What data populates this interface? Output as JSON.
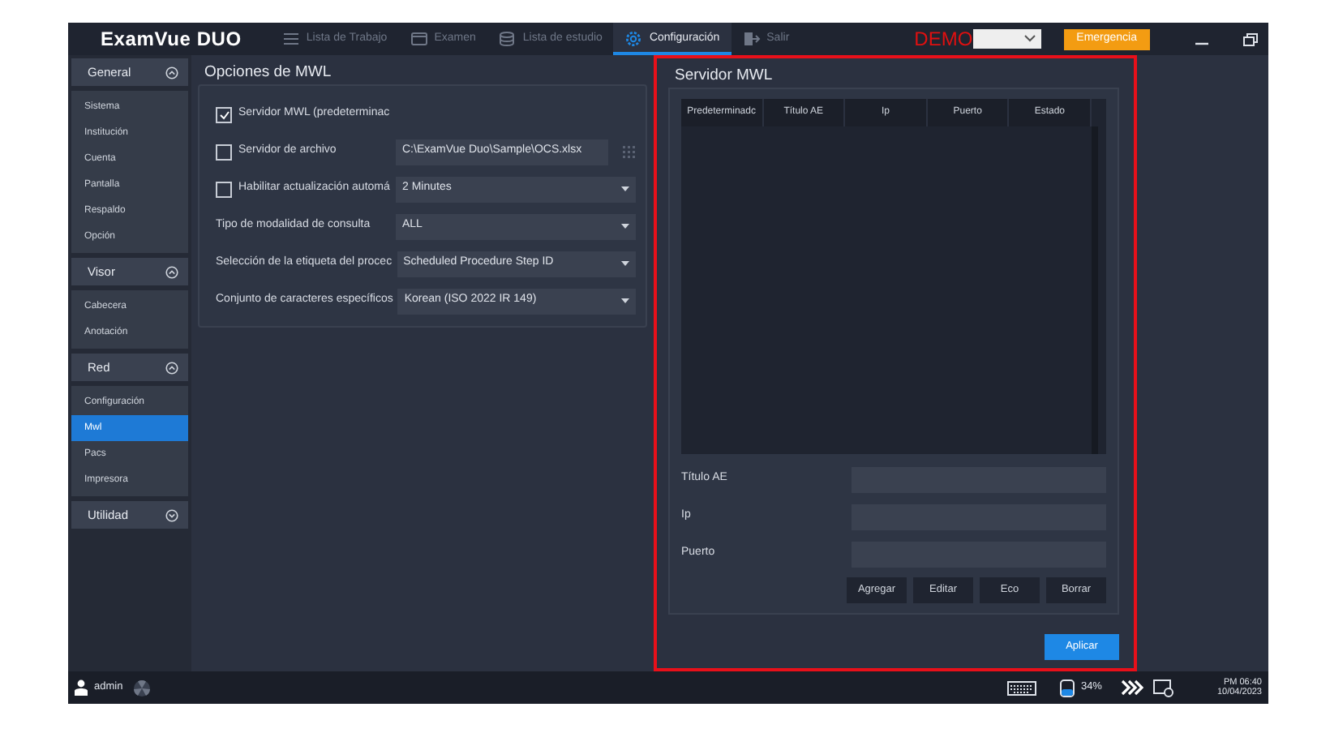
{
  "top_bar": {
    "logo": "ExamVue DUO",
    "nav": [
      {
        "label": "Lista de Trabajo",
        "selected": false
      },
      {
        "label": "Examen",
        "selected": false
      },
      {
        "label": "Lista de estudio",
        "selected": false
      },
      {
        "label": "Configuración",
        "selected": true
      },
      {
        "label": "Salir",
        "selected": false
      }
    ],
    "demo": "DEMO",
    "emergency_button": "Emergencia"
  },
  "sidebar": {
    "groups": [
      {
        "label": "General",
        "expanded": true,
        "items": [
          {
            "label": "Sistema",
            "selected": false
          },
          {
            "label": "Institución",
            "selected": false
          },
          {
            "label": "Cuenta",
            "selected": false
          },
          {
            "label": "Pantalla",
            "selected": false
          },
          {
            "label": "Respaldo",
            "selected": false
          },
          {
            "label": "Opción",
            "selected": false
          }
        ]
      },
      {
        "label": "Visor",
        "expanded": true,
        "items": [
          {
            "label": "Cabecera",
            "selected": false
          },
          {
            "label": "Anotación",
            "selected": false
          }
        ]
      },
      {
        "label": "Red",
        "expanded": true,
        "items": [
          {
            "label": "Configuración",
            "selected": false
          },
          {
            "label": "Mwl",
            "selected": true
          },
          {
            "label": "Pacs",
            "selected": false
          },
          {
            "label": "Impresora",
            "selected": false
          }
        ]
      },
      {
        "label": "Utilidad",
        "expanded": false
      }
    ]
  },
  "mwl_options": {
    "title": "Opciones de MWL",
    "rows": [
      {
        "kind": "checkbox",
        "label": "Servidor MWL (predeterminac",
        "checked": true
      },
      {
        "kind": "checkbox_file",
        "label": "Servidor de archivo",
        "checked": false,
        "value": "C:\\ExamVue Duo\\Sample\\OCS.xlsx"
      },
      {
        "kind": "checkbox_select",
        "label": "Habilitar actualización automá",
        "checked": false,
        "value": "2 Minutes"
      },
      {
        "kind": "select",
        "label": "Tipo de modalidad de consulta",
        "value": "ALL"
      },
      {
        "kind": "select",
        "label": "Selección de la etiqueta del procec",
        "value": "Scheduled Procedure Step ID"
      },
      {
        "kind": "select",
        "label": "Conjunto de caracteres específicos",
        "value": "Korean (ISO 2022 IR 149)"
      }
    ]
  },
  "mwl_server": {
    "title": "Servidor MWL",
    "table": {
      "columns": [
        "Predeterminadc",
        "Título AE",
        "Ip",
        "Puerto",
        "Estado"
      ]
    },
    "fields": [
      {
        "label": "Título AE"
      },
      {
        "label": "Ip"
      },
      {
        "label": "Puerto"
      }
    ],
    "buttons": [
      "Agregar",
      "Editar",
      "Eco",
      "Borrar"
    ],
    "apply_button": "Aplicar"
  },
  "status_bar": {
    "user": "admin",
    "battery": "34%",
    "time": "PM 06:40",
    "date": "10/04/2023"
  }
}
